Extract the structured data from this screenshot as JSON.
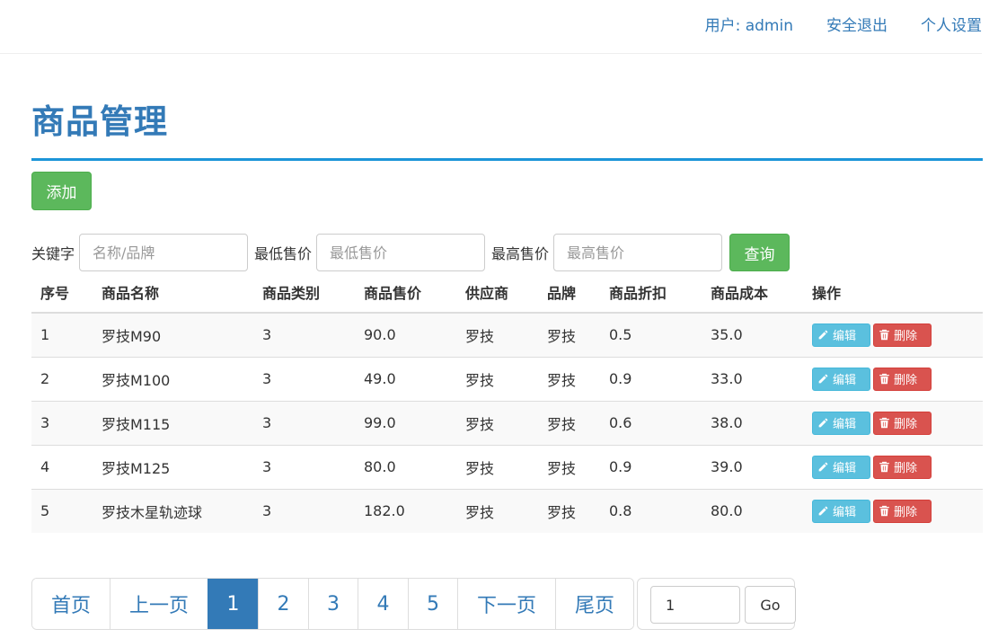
{
  "header": {
    "user_label": "用户: admin",
    "logout_label": "安全退出",
    "settings_label": "个人设置"
  },
  "page_title": "商品管理",
  "add_label": "添加",
  "search": {
    "keyword_label": "关键字",
    "keyword_placeholder": "名称/品牌",
    "min_price_label": "最低售价",
    "min_price_placeholder": "最低售价",
    "max_price_label": "最高售价",
    "max_price_placeholder": "最高售价",
    "submit_label": "查询"
  },
  "table": {
    "headers": [
      "序号",
      "商品名称",
      "商品类别",
      "商品售价",
      "供应商",
      "品牌",
      "商品折扣",
      "商品成本",
      "操作"
    ],
    "edit_label": "编辑",
    "delete_label": "删除",
    "rows": [
      [
        "1",
        "罗技M90",
        "3",
        "90.0",
        "罗技",
        "罗技",
        "0.5",
        "35.0"
      ],
      [
        "2",
        "罗技M100",
        "3",
        "49.0",
        "罗技",
        "罗技",
        "0.9",
        "33.0"
      ],
      [
        "3",
        "罗技M115",
        "3",
        "99.0",
        "罗技",
        "罗技",
        "0.6",
        "38.0"
      ],
      [
        "4",
        "罗技M125",
        "3",
        "80.0",
        "罗技",
        "罗技",
        "0.9",
        "39.0"
      ],
      [
        "5",
        "罗技木星轨迹球",
        "3",
        "182.0",
        "罗技",
        "罗技",
        "0.8",
        "80.0"
      ]
    ]
  },
  "pagination": {
    "first": "首页",
    "prev": "上一页",
    "pages": [
      "1",
      "2",
      "3",
      "4",
      "5"
    ],
    "current": "1",
    "next": "下一页",
    "last": "尾页"
  },
  "goto": {
    "value": "1",
    "button_label": "Go"
  },
  "colors": {
    "primary": "#337ab7",
    "success": "#5cb85c",
    "info": "#5bc0de",
    "danger": "#d9534f",
    "rule": "#1c95d8"
  }
}
